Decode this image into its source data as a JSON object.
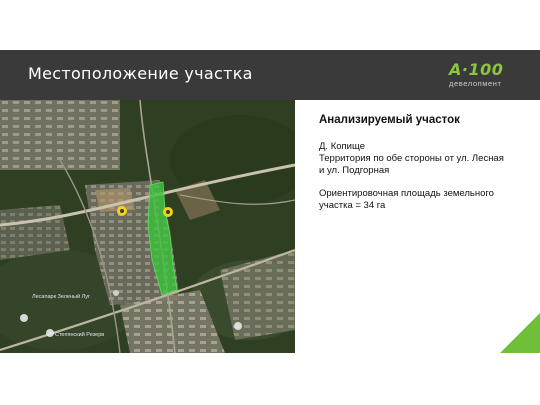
{
  "header": {
    "title": "Местоположение участка",
    "logo_mark": "A·100",
    "logo_sub": "девелопмент"
  },
  "map": {
    "labels": {
      "forest_park": "Лесапарк Зеленый Луг",
      "reserve": "Степянский Резерв"
    },
    "colors": {
      "plot_fill": "#39c43a",
      "marker": "#f2d31b"
    }
  },
  "info": {
    "heading": "Анализируемый участок",
    "lines_a": [
      "Д. Копище",
      "Территория по обе стороны от ул. Лесная",
      "и ул. Подгорная"
    ],
    "lines_b": [
      "Ориентировочная площадь земельного",
      "участка = 34 га"
    ]
  },
  "colors": {
    "header_bg": "#3a3a3a",
    "brand_green": "#8cc63f",
    "accent_green": "#6fbf3a"
  }
}
